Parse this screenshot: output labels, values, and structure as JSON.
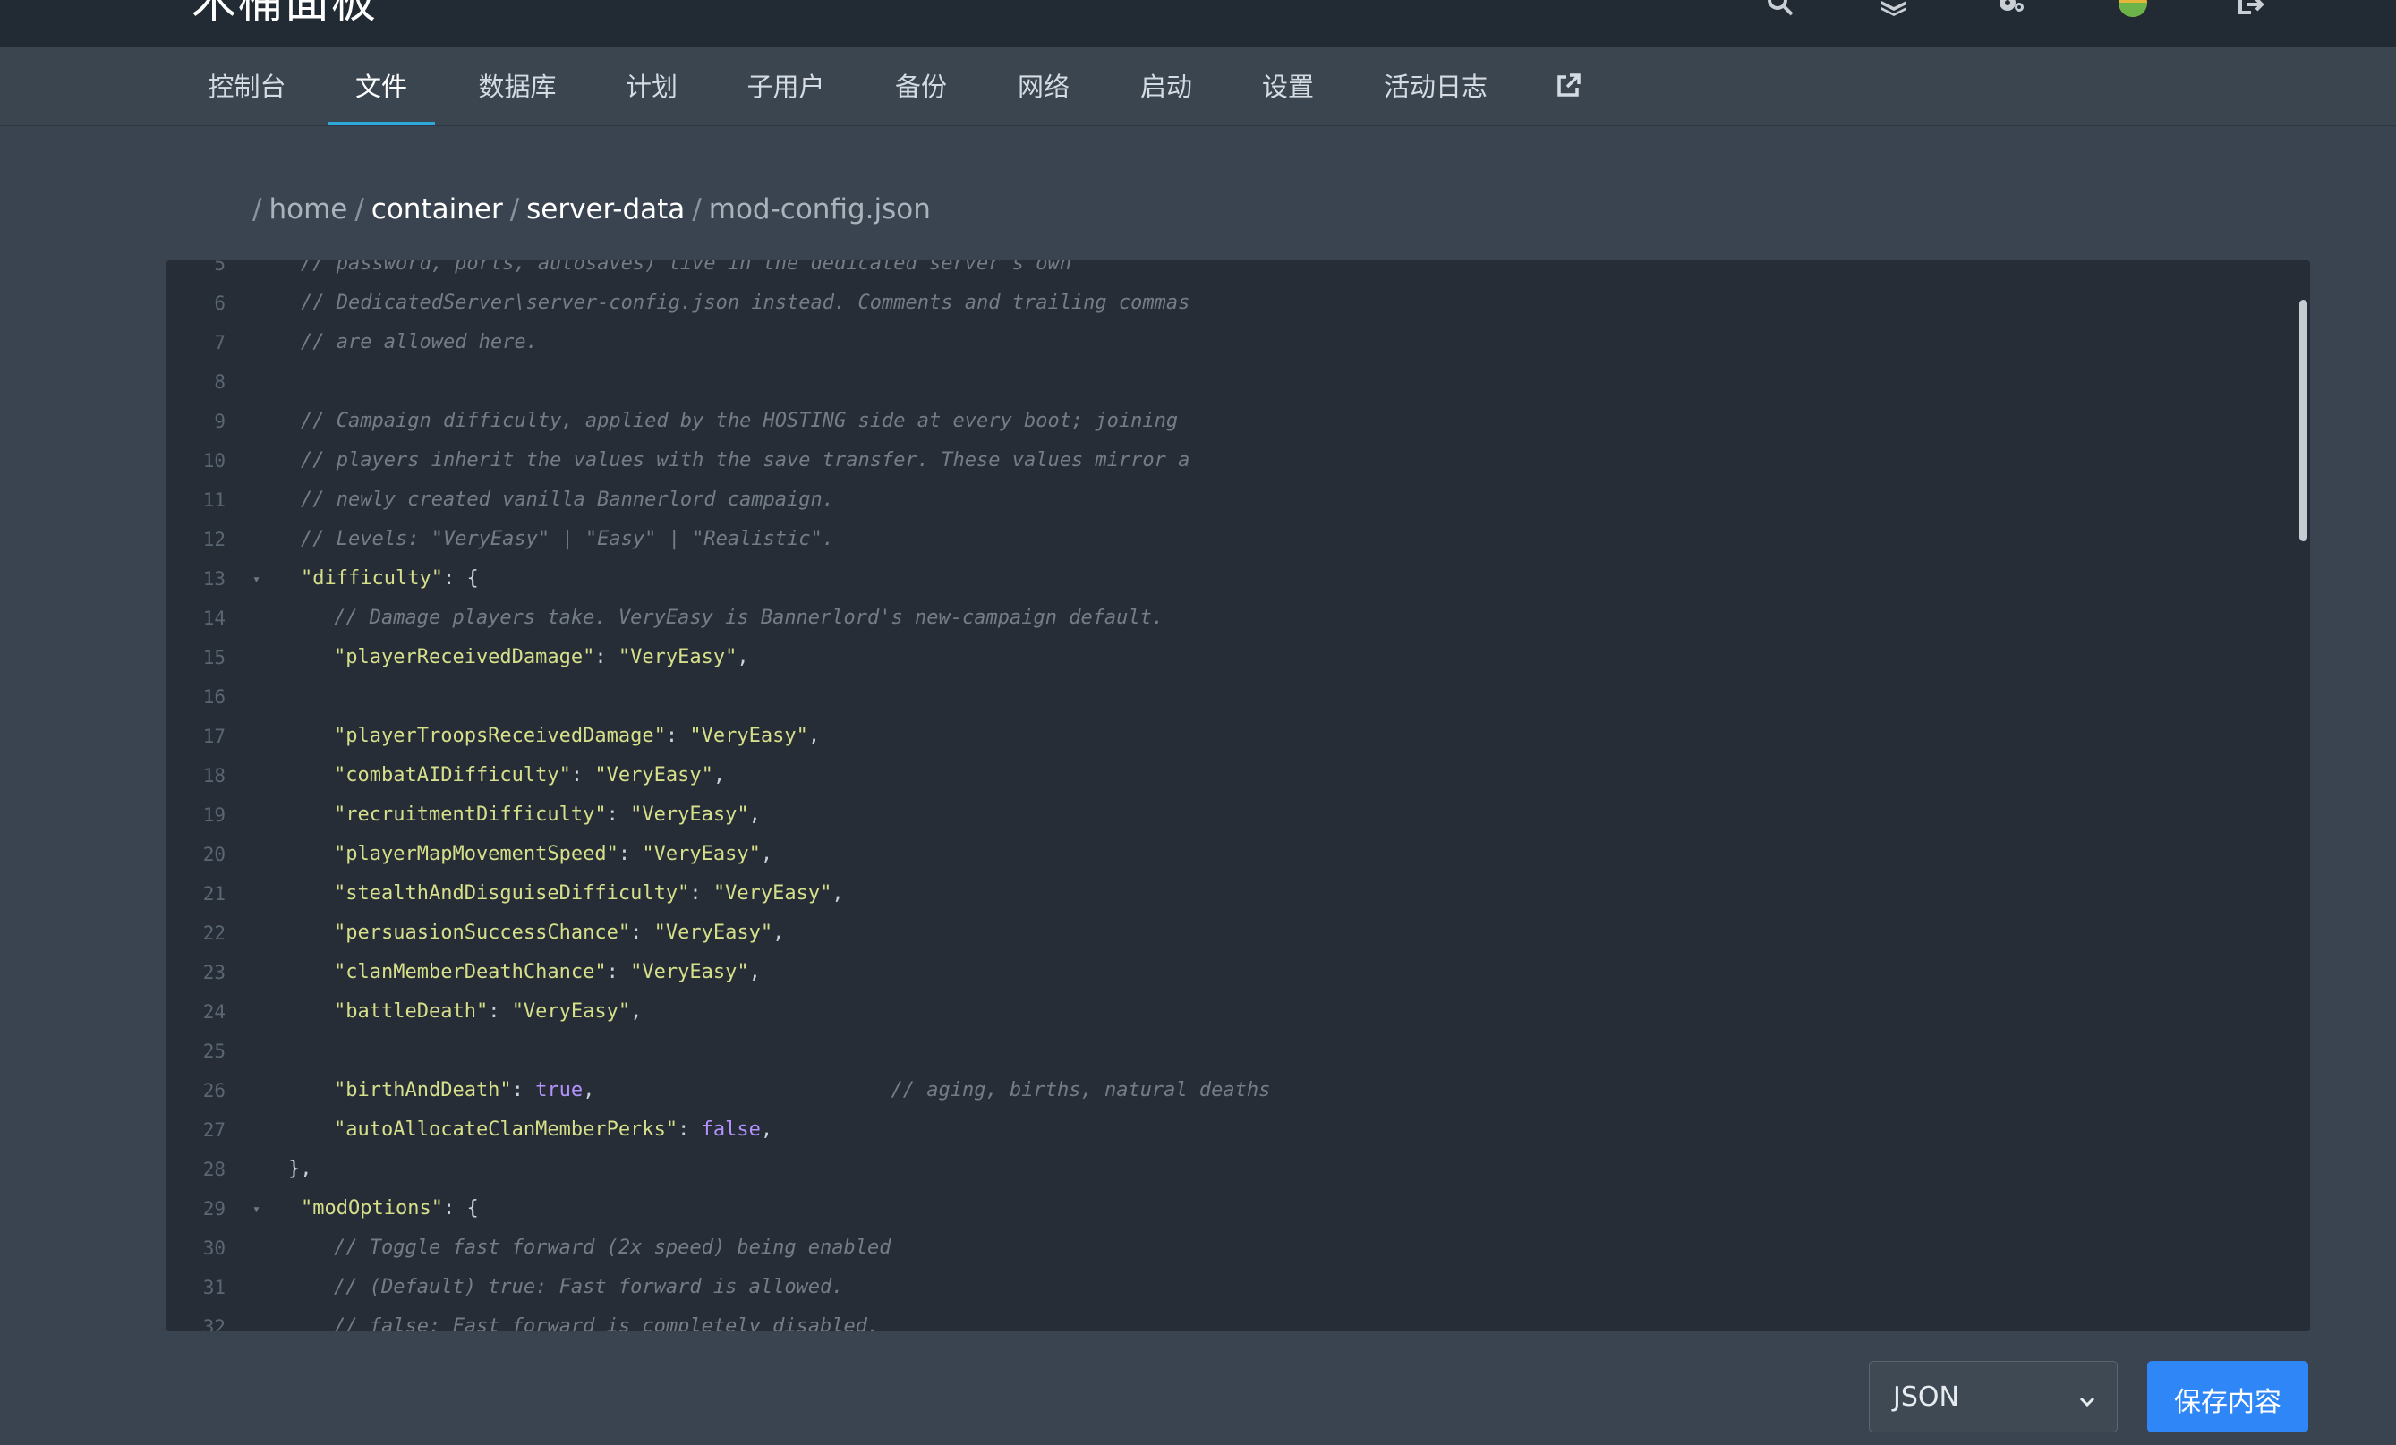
{
  "app": {
    "brand": "木桶面板"
  },
  "top_icons": [
    {
      "name": "search-icon"
    },
    {
      "name": "layers-icon"
    },
    {
      "name": "gear-icon"
    },
    {
      "name": "avatar"
    },
    {
      "name": "logout-icon"
    }
  ],
  "tabs": [
    {
      "label": "控制台",
      "active": false
    },
    {
      "label": "文件",
      "active": true
    },
    {
      "label": "数据库",
      "active": false
    },
    {
      "label": "计划",
      "active": false
    },
    {
      "label": "子用户",
      "active": false
    },
    {
      "label": "备份",
      "active": false
    },
    {
      "label": "网络",
      "active": false
    },
    {
      "label": "启动",
      "active": false
    },
    {
      "label": "设置",
      "active": false
    },
    {
      "label": "活动日志",
      "active": false
    }
  ],
  "breadcrumb": {
    "sep": "/",
    "seg1": "home",
    "seg2": "container",
    "seg3": "server-data",
    "file": "mod-config.json"
  },
  "editor": {
    "lines": [
      {
        "n": "5",
        "indent": 0,
        "parts": [
          {
            "t": "c",
            "v": "// password, ports, autosaves) live in the dedicated server's own"
          }
        ]
      },
      {
        "n": "6",
        "indent": 0,
        "parts": [
          {
            "t": "c",
            "v": "// DedicatedServer\\server-config.json instead. Comments and trailing commas"
          }
        ]
      },
      {
        "n": "7",
        "indent": 0,
        "parts": [
          {
            "t": "c",
            "v": "// are allowed here."
          }
        ]
      },
      {
        "n": "8",
        "indent": 0,
        "parts": []
      },
      {
        "n": "9",
        "indent": 0,
        "parts": [
          {
            "t": "c",
            "v": "// Campaign difficulty, applied by the HOSTING side at every boot; joining"
          }
        ]
      },
      {
        "n": "10",
        "indent": 0,
        "parts": [
          {
            "t": "c",
            "v": "// players inherit the values with the save transfer. These values mirror a"
          }
        ]
      },
      {
        "n": "11",
        "indent": 0,
        "parts": [
          {
            "t": "c",
            "v": "// newly created vanilla Bannerlord campaign."
          }
        ]
      },
      {
        "n": "12",
        "indent": 0,
        "parts": [
          {
            "t": "c",
            "v": "// Levels: \"VeryEasy\" | \"Easy\" | \"Realistic\"."
          }
        ]
      },
      {
        "n": "13",
        "indent": 0,
        "fold": true,
        "parts": [
          {
            "t": "k",
            "v": "\"difficulty\""
          },
          {
            "t": "p",
            "v": ": {"
          }
        ]
      },
      {
        "n": "14",
        "indent": 1,
        "parts": [
          {
            "t": "c",
            "v": "// Damage players take. VeryEasy is Bannerlord's new-campaign default."
          }
        ]
      },
      {
        "n": "15",
        "indent": 1,
        "parts": [
          {
            "t": "k",
            "v": "\"playerReceivedDamage\""
          },
          {
            "t": "p",
            "v": ": "
          },
          {
            "t": "s",
            "v": "\"VeryEasy\""
          },
          {
            "t": "p",
            "v": ","
          }
        ]
      },
      {
        "n": "16",
        "indent": 1,
        "parts": []
      },
      {
        "n": "17",
        "indent": 1,
        "parts": [
          {
            "t": "k",
            "v": "\"playerTroopsReceivedDamage\""
          },
          {
            "t": "p",
            "v": ": "
          },
          {
            "t": "s",
            "v": "\"VeryEasy\""
          },
          {
            "t": "p",
            "v": ","
          }
        ]
      },
      {
        "n": "18",
        "indent": 1,
        "parts": [
          {
            "t": "k",
            "v": "\"combatAIDifficulty\""
          },
          {
            "t": "p",
            "v": ": "
          },
          {
            "t": "s",
            "v": "\"VeryEasy\""
          },
          {
            "t": "p",
            "v": ","
          }
        ]
      },
      {
        "n": "19",
        "indent": 1,
        "parts": [
          {
            "t": "k",
            "v": "\"recruitmentDifficulty\""
          },
          {
            "t": "p",
            "v": ": "
          },
          {
            "t": "s",
            "v": "\"VeryEasy\""
          },
          {
            "t": "p",
            "v": ","
          }
        ]
      },
      {
        "n": "20",
        "indent": 1,
        "parts": [
          {
            "t": "k",
            "v": "\"playerMapMovementSpeed\""
          },
          {
            "t": "p",
            "v": ": "
          },
          {
            "t": "s",
            "v": "\"VeryEasy\""
          },
          {
            "t": "p",
            "v": ","
          }
        ]
      },
      {
        "n": "21",
        "indent": 1,
        "parts": [
          {
            "t": "k",
            "v": "\"stealthAndDisguiseDifficulty\""
          },
          {
            "t": "p",
            "v": ": "
          },
          {
            "t": "s",
            "v": "\"VeryEasy\""
          },
          {
            "t": "p",
            "v": ","
          }
        ]
      },
      {
        "n": "22",
        "indent": 1,
        "parts": [
          {
            "t": "k",
            "v": "\"persuasionSuccessChance\""
          },
          {
            "t": "p",
            "v": ": "
          },
          {
            "t": "s",
            "v": "\"VeryEasy\""
          },
          {
            "t": "p",
            "v": ","
          }
        ]
      },
      {
        "n": "23",
        "indent": 1,
        "parts": [
          {
            "t": "k",
            "v": "\"clanMemberDeathChance\""
          },
          {
            "t": "p",
            "v": ": "
          },
          {
            "t": "s",
            "v": "\"VeryEasy\""
          },
          {
            "t": "p",
            "v": ","
          }
        ]
      },
      {
        "n": "24",
        "indent": 1,
        "parts": [
          {
            "t": "k",
            "v": "\"battleDeath\""
          },
          {
            "t": "p",
            "v": ": "
          },
          {
            "t": "s",
            "v": "\"VeryEasy\""
          },
          {
            "t": "p",
            "v": ","
          }
        ]
      },
      {
        "n": "25",
        "indent": 1,
        "parts": []
      },
      {
        "n": "26",
        "indent": 1,
        "parts": [
          {
            "t": "k",
            "v": "\"birthAndDeath\""
          },
          {
            "t": "p",
            "v": ": "
          },
          {
            "t": "b",
            "v": "true"
          },
          {
            "t": "p",
            "v": ",                         "
          },
          {
            "t": "c",
            "v": "// aging, births, natural deaths"
          }
        ]
      },
      {
        "n": "27",
        "indent": 1,
        "parts": [
          {
            "t": "k",
            "v": "\"autoAllocateClanMemberPerks\""
          },
          {
            "t": "p",
            "v": ": "
          },
          {
            "t": "b",
            "v": "false"
          },
          {
            "t": "p",
            "v": ","
          }
        ]
      },
      {
        "n": "28",
        "indent": -1,
        "parts": [
          {
            "t": "p",
            "v": "},"
          }
        ]
      },
      {
        "n": "29",
        "indent": 0,
        "fold": true,
        "parts": [
          {
            "t": "k",
            "v": "\"modOptions\""
          },
          {
            "t": "p",
            "v": ": {"
          }
        ]
      },
      {
        "n": "30",
        "indent": 1,
        "parts": [
          {
            "t": "c",
            "v": "// Toggle fast forward (2x speed) being enabled"
          }
        ]
      },
      {
        "n": "31",
        "indent": 1,
        "parts": [
          {
            "t": "c",
            "v": "// (Default) true: Fast forward is allowed."
          }
        ]
      },
      {
        "n": "32",
        "indent": 1,
        "parts": [
          {
            "t": "c",
            "v": "// false: Fast forward is completely disabled."
          }
        ]
      }
    ]
  },
  "footer": {
    "mode_value": "JSON",
    "save_label": "保存内容"
  }
}
